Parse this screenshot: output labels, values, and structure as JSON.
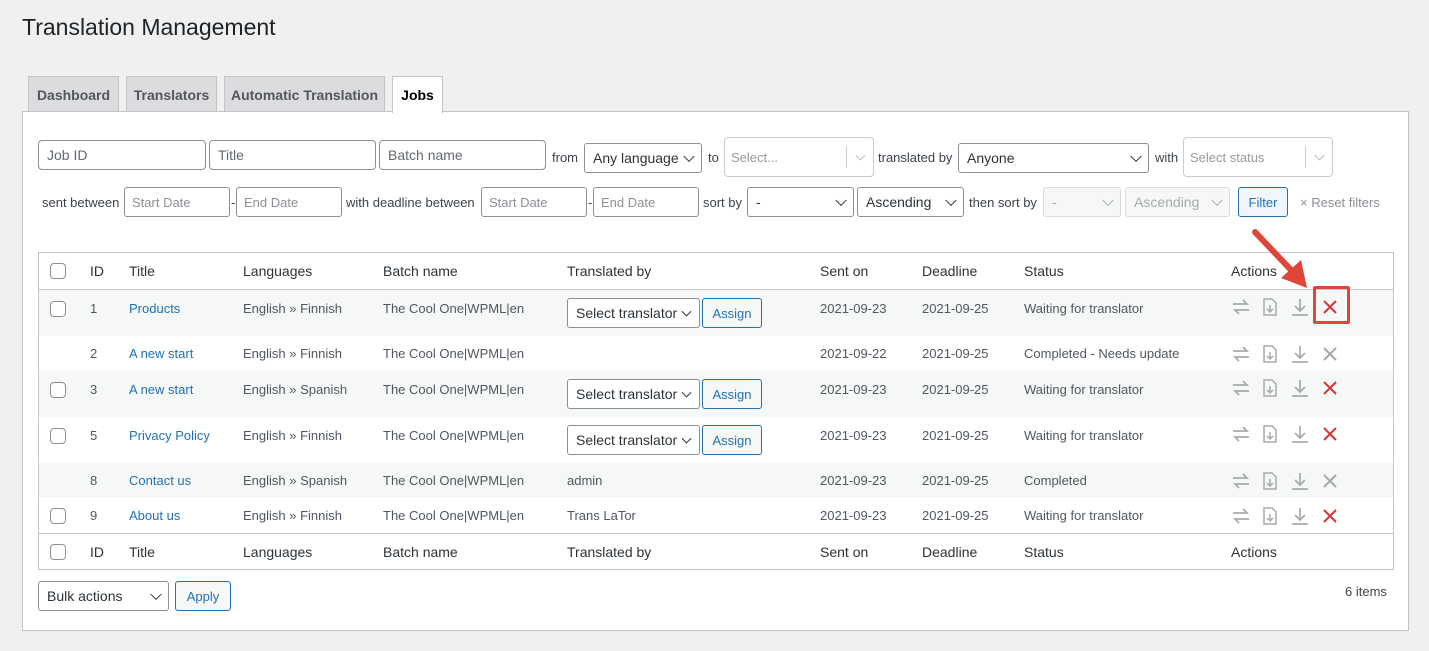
{
  "page": {
    "title": "Translation Management"
  },
  "tabs": [
    {
      "label": "Dashboard",
      "active": false
    },
    {
      "label": "Translators",
      "active": false
    },
    {
      "label": "Automatic Translation",
      "active": false
    },
    {
      "label": "Jobs",
      "active": true
    }
  ],
  "filters": {
    "job_id_placeholder": "Job ID",
    "title_placeholder": "Title",
    "batch_placeholder": "Batch name",
    "from_label": "from",
    "from_value": "Any language",
    "to_label": "to",
    "to_placeholder": "Select...",
    "translated_by_label": "translated by",
    "translated_by_value": "Anyone",
    "with_label": "with",
    "status_placeholder": "Select status",
    "sent_between_label": "sent between",
    "sent_start_placeholder": "Start Date",
    "sent_end_placeholder": "End Date",
    "dash": "-",
    "deadline_between_label": "with deadline between",
    "deadline_start_placeholder": "Start Date",
    "deadline_end_placeholder": "End Date",
    "sort_by_label": "sort by",
    "sort_by_value": "-",
    "sort_order_value": "Ascending",
    "then_sort_by_label": "then sort by",
    "then_sort_by_value": "-",
    "then_sort_order_value": "Ascending",
    "filter_button": "Filter",
    "reset_link": "× Reset filters"
  },
  "table": {
    "columns": [
      "ID",
      "Title",
      "Languages",
      "Batch name",
      "Translated by",
      "Sent on",
      "Deadline",
      "Status",
      "Actions"
    ],
    "rows": [
      {
        "id": "1",
        "title": "Products",
        "languages": "English » Finnish",
        "batch": "The Cool One|WPML|en",
        "translated_by": "",
        "translator_select": "Select translator",
        "assign": "Assign",
        "sent_on": "2021-09-23",
        "deadline": "2021-09-25",
        "status": "Waiting for translator"
      },
      {
        "id": "2",
        "title": "A new start",
        "languages": "English » Finnish",
        "batch": "The Cool One|WPML|en",
        "translated_by": "",
        "translator_select": "",
        "assign": "",
        "sent_on": "2021-09-22",
        "deadline": "2021-09-25",
        "status": "Completed - Needs update"
      },
      {
        "id": "3",
        "title": "A new start",
        "languages": "English » Spanish",
        "batch": "The Cool One|WPML|en",
        "translated_by": "",
        "translator_select": "Select translator",
        "assign": "Assign",
        "sent_on": "2021-09-23",
        "deadline": "2021-09-25",
        "status": "Waiting for translator"
      },
      {
        "id": "5",
        "title": "Privacy Policy",
        "languages": "English » Finnish",
        "batch": "The Cool One|WPML|en",
        "translated_by": "",
        "translator_select": "Select translator",
        "assign": "Assign",
        "sent_on": "2021-09-23",
        "deadline": "2021-09-25",
        "status": "Waiting for translator"
      },
      {
        "id": "8",
        "title": "Contact us",
        "languages": "English » Spanish",
        "batch": "The Cool One|WPML|en",
        "translated_by": "admin",
        "translator_select": "",
        "assign": "",
        "sent_on": "2021-09-23",
        "deadline": "2021-09-25",
        "status": "Completed"
      },
      {
        "id": "9",
        "title": "About us",
        "languages": "English » Finnish",
        "batch": "The Cool One|WPML|en",
        "translated_by": "Trans LaTor",
        "translator_select": "",
        "assign": "",
        "sent_on": "2021-09-23",
        "deadline": "2021-09-25",
        "status": "Waiting for translator"
      }
    ]
  },
  "bulk": {
    "select_value": "Bulk actions",
    "apply_button": "Apply"
  },
  "items_count": "6 items",
  "colors": {
    "link": "#2271b1",
    "delete_active": "#d63638",
    "icon_muted": "#a7aaad",
    "annotation": "#e0453a"
  },
  "icons": [
    "translate-arrows-icon",
    "download-xliff-icon",
    "download-icon",
    "delete-icon"
  ]
}
